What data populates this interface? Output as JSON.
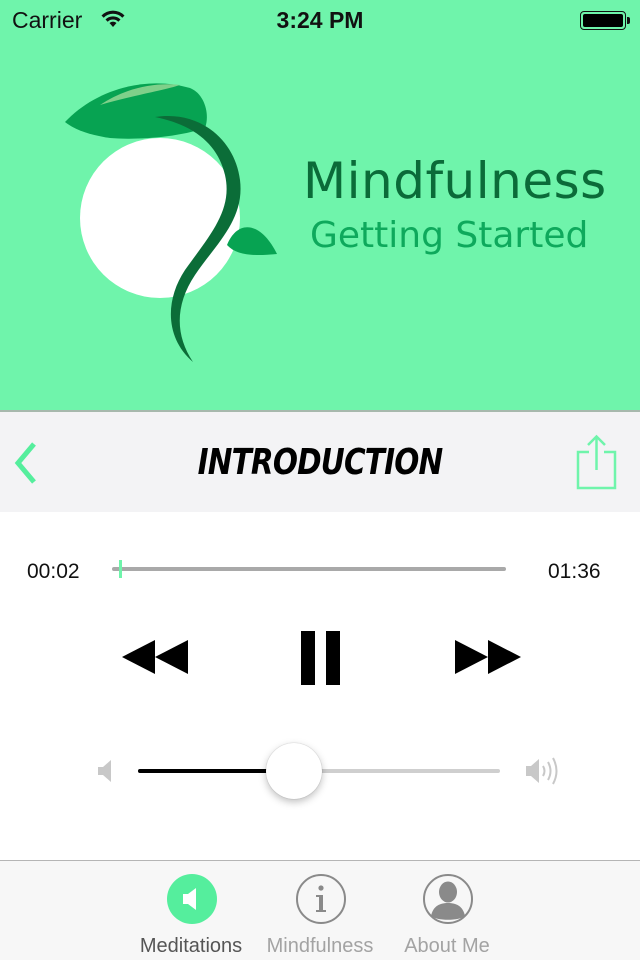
{
  "status_bar": {
    "carrier": "Carrier",
    "time": "3:24 PM",
    "wifi_icon": "wifi-icon",
    "battery_icon": "battery-full-icon"
  },
  "banner": {
    "title": "Mindfulness",
    "subtitle": "Getting Started",
    "logo_icon": "sprout-leaf-logo"
  },
  "navbar": {
    "back_icon": "chevron-left-icon",
    "title": "INTRODUCTION",
    "share_icon": "share-icon"
  },
  "player": {
    "current_time": "00:02",
    "duration": "01:36",
    "progress_fraction": 0.02,
    "controls": [
      "rewind-icon",
      "pause-icon",
      "fast-forward-icon"
    ],
    "volume_fraction": 0.43,
    "volume_min_icon": "speaker-low-icon",
    "volume_max_icon": "speaker-high-icon"
  },
  "tabbar": {
    "items": [
      {
        "label": "Meditations",
        "icon": "speaker-icon",
        "active": true
      },
      {
        "label": "Mindfulness",
        "icon": "info-icon",
        "active": false
      },
      {
        "label": "About Me",
        "icon": "person-icon",
        "active": false
      }
    ]
  },
  "colors": {
    "accent": "#6ff4ab",
    "tab_active": "#55ee9d",
    "brand_dark": "#0b6b39",
    "brand_mid": "#0ea95c"
  }
}
